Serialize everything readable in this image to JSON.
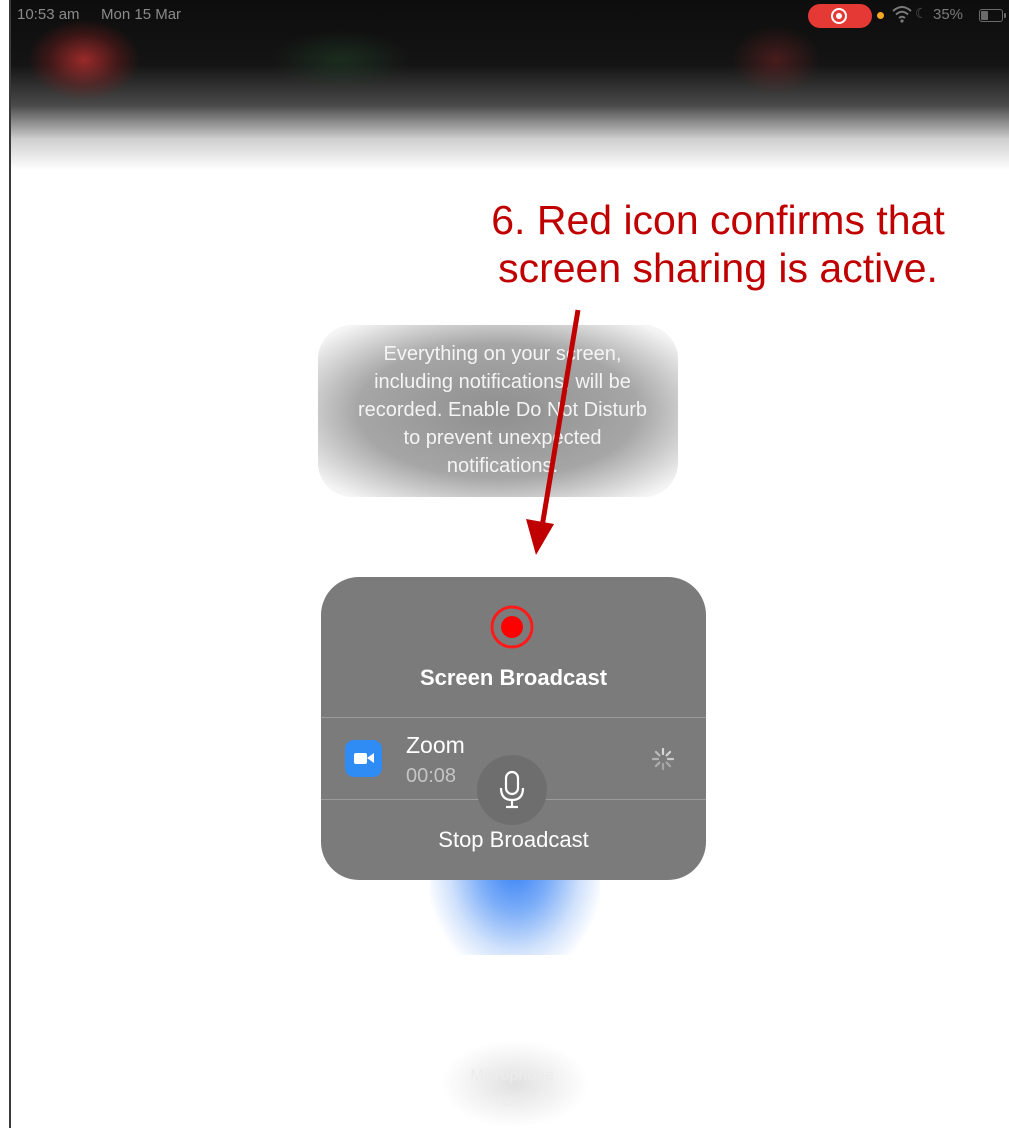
{
  "status_bar": {
    "time": "10:53 am",
    "date": "Mon 15 Mar",
    "battery_percent": "35%",
    "recording_indicator_color": "#e53935"
  },
  "annotation": {
    "line1": "6. Red icon confirms that",
    "line2": "screen sharing is active.",
    "color": "#c00000"
  },
  "info_message": {
    "line1": "Everything on your screen,",
    "line2": "including notifications, will be",
    "line3": "recorded. Enable Do Not Disturb",
    "line4": "to prevent unexpected",
    "line5": "notifications."
  },
  "broadcast_panel": {
    "title": "Screen Broadcast",
    "app_name": "Zoom",
    "elapsed": "00:08",
    "stop_label": "Stop Broadcast",
    "record_icon_color": "#ff0000",
    "app_icon_color": "#2f8cf5"
  },
  "microphone": {
    "label_line1": "Microphone",
    "label_line2": "Off"
  },
  "icons": [
    "record-indicator-icon",
    "wifi-icon",
    "do-not-disturb-icon",
    "battery-icon",
    "record-icon",
    "zoom-app-icon",
    "loading-spinner-icon",
    "microphone-icon",
    "arrow-icon"
  ]
}
